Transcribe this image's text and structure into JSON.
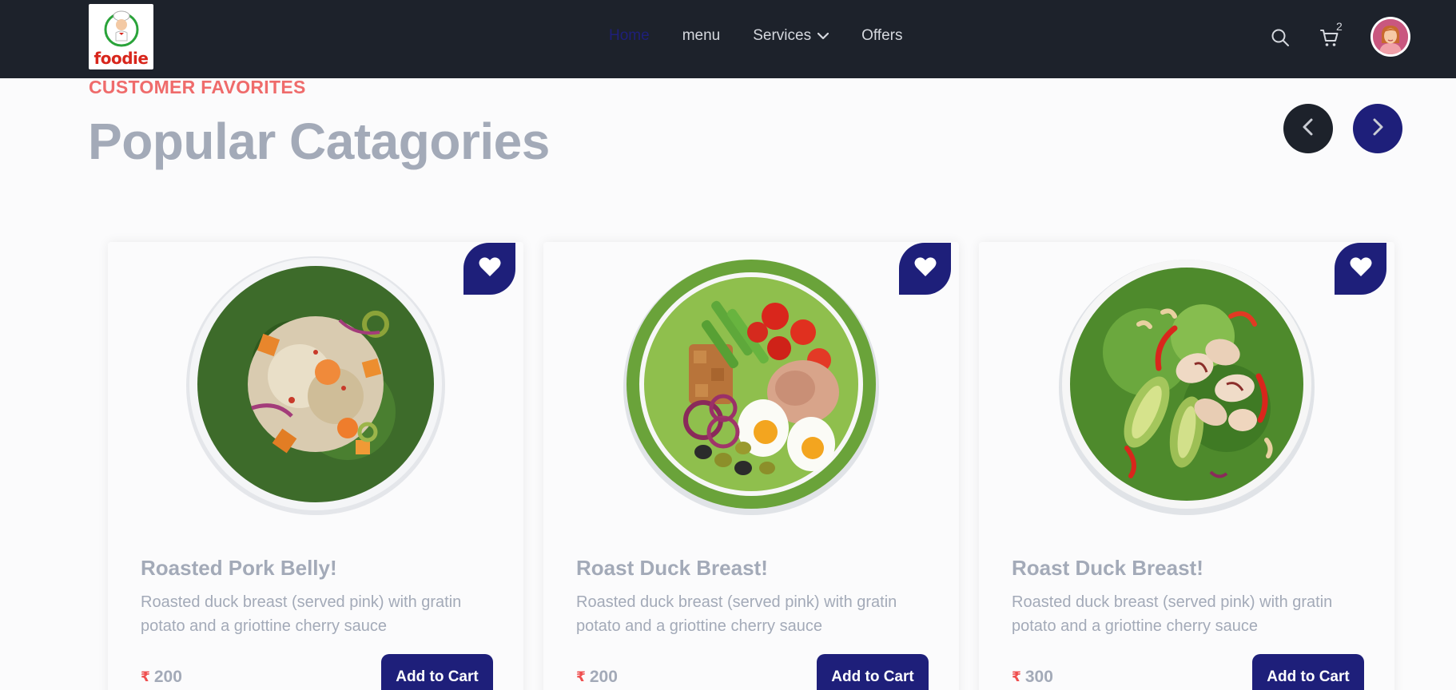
{
  "brand": {
    "logo_text": "foodie"
  },
  "nav": {
    "links": [
      {
        "label": "Home",
        "active": true
      },
      {
        "label": "menu",
        "active": false
      },
      {
        "label": "Services",
        "active": false,
        "has_dropdown": true
      },
      {
        "label": "Offers",
        "active": false
      }
    ],
    "cart_count": "2",
    "icons": [
      "search-icon",
      "cart-icon",
      "avatar"
    ]
  },
  "section": {
    "eyebrow": "CUSTOMER FAVORITES",
    "title": "Popular Catagories"
  },
  "carousel": {
    "prev_icon": "chevron-left-icon",
    "next_icon": "chevron-right-icon"
  },
  "cards": [
    {
      "name": "Roasted Pork Belly!",
      "description": "Roasted duck breast (served pink) with gratin potato and a griottine cherry sauce",
      "currency": "₹",
      "price": "200",
      "button": "Add to Cart"
    },
    {
      "name": "Roast Duck Breast!",
      "description": "Roasted duck breast (served pink) with gratin potato and a griottine cherry sauce",
      "currency": "₹",
      "price": "200",
      "button": "Add to Cart"
    },
    {
      "name": "Roast Duck Breast!",
      "description": "Roasted duck breast (served pink) with gratin potato and a griottine cherry sauce",
      "currency": "₹",
      "price": "300",
      "button": "Add to Cart"
    }
  ],
  "colors": {
    "navbar_bg": "#1d222b",
    "accent_navy": "#1e1f7a",
    "eyebrow_red": "#ef6b6b",
    "muted_text": "#a3aab8"
  }
}
